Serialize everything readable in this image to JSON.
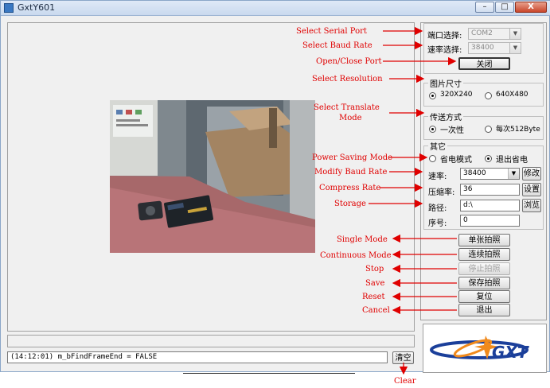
{
  "window": {
    "title": "GxtY601",
    "controls": {
      "minimize": "–",
      "maximize": "□",
      "close": "X"
    }
  },
  "log": {
    "text": "(14:12:01) m_bFindFrameEnd = FALSE"
  },
  "clear_button": "清空",
  "serial": {
    "port_label": "端口选择:",
    "port_value": "COM2",
    "baud_label": "速率选择:",
    "baud_value": "38400",
    "open_close_button": "关闭"
  },
  "resolution": {
    "title": "图片尺寸",
    "options": [
      "320X240",
      "640X480"
    ],
    "selected": "320X240"
  },
  "transfer": {
    "title": "传送方式",
    "options": [
      "一次性",
      "每次512Byte"
    ],
    "selected": "一次性"
  },
  "other": {
    "title": "其它",
    "power_options": [
      "省电模式",
      "退出省电"
    ],
    "power_selected": "退出省电",
    "rate_label": "速率:",
    "rate_value": "38400",
    "modify_button": "修改",
    "compress_label": "压缩率:",
    "compress_value": "36",
    "set_button": "设置",
    "path_label": "路径:",
    "path_value": "d:\\",
    "browse_button": "浏览",
    "seq_label": "序号:",
    "seq_value": "0"
  },
  "actions": {
    "single": "单张拍照",
    "continuous": "连续拍照",
    "stop": "停止拍照",
    "save": "保存拍照",
    "reset": "复位",
    "exit": "退出"
  },
  "logo": {
    "text": "GXT"
  },
  "annotations": {
    "select_serial_port": "Select Serial Port",
    "select_baud_rate": "Select Baud Rate",
    "open_close_port": "Open/Close Port",
    "select_resolution": "Select Resolution",
    "select_translate_mode_1": "Select Translate",
    "select_translate_mode_2": "Mode",
    "power_saving_mode": "Power Saving Mode",
    "modify_baud_rate": "Modify Baud Rate",
    "compress_rate": "Compress Rate",
    "storage": "Storage",
    "single_mode": "Single Mode",
    "continuous_mode": "Continuous Mode",
    "stop": "Stop",
    "save": "Save",
    "reset": "Reset",
    "cancel": "Cancel",
    "clear": "Clear"
  },
  "colors": {
    "annotation": "#e00000",
    "logo_blue": "#1b3f9a",
    "logo_orange": "#f08a1c"
  }
}
